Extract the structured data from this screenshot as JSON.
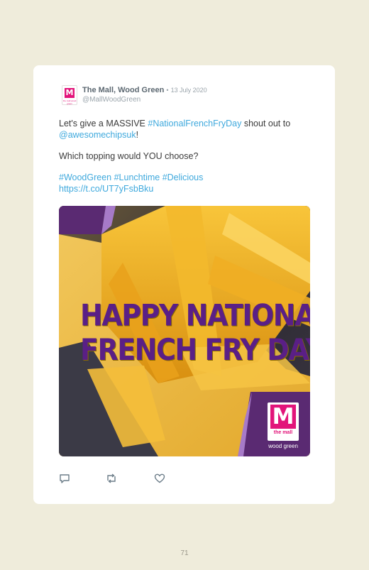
{
  "tweet": {
    "display_name": "The Mall, Wood Green",
    "separator": "•",
    "date": "13 July 2020",
    "handle": "@MallWoodGreen",
    "avatar_letter": "M",
    "avatar_sub": "the mall wood green",
    "line1_prefix": "Let's give a MASSIVE ",
    "line1_hashtag": "#NationalFrenchFryDay",
    "line1_suffix": " shout out to",
    "line2_mention": "@awesomechipsuk",
    "line2_suffix": "!",
    "question": "Which topping would YOU choose?",
    "hashtags": "#WoodGreen #Lunchtime #Delicious",
    "url": "https://t.co/UT7yFsbBku"
  },
  "media": {
    "headline_line1": "HAPPY NATIONAL",
    "headline_line2": "FRENCH FRY DAY!",
    "logo_letter": "M",
    "logo_sub": "the mall",
    "logo_caption": "wood green"
  },
  "actions": [
    "reply-icon",
    "retweet-icon",
    "like-icon"
  ],
  "colors": {
    "background": "#efecdb",
    "link": "#3fa9dd",
    "brand_pink": "#e2147a",
    "brand_purple": "#5a1f86"
  },
  "page_number": "71"
}
